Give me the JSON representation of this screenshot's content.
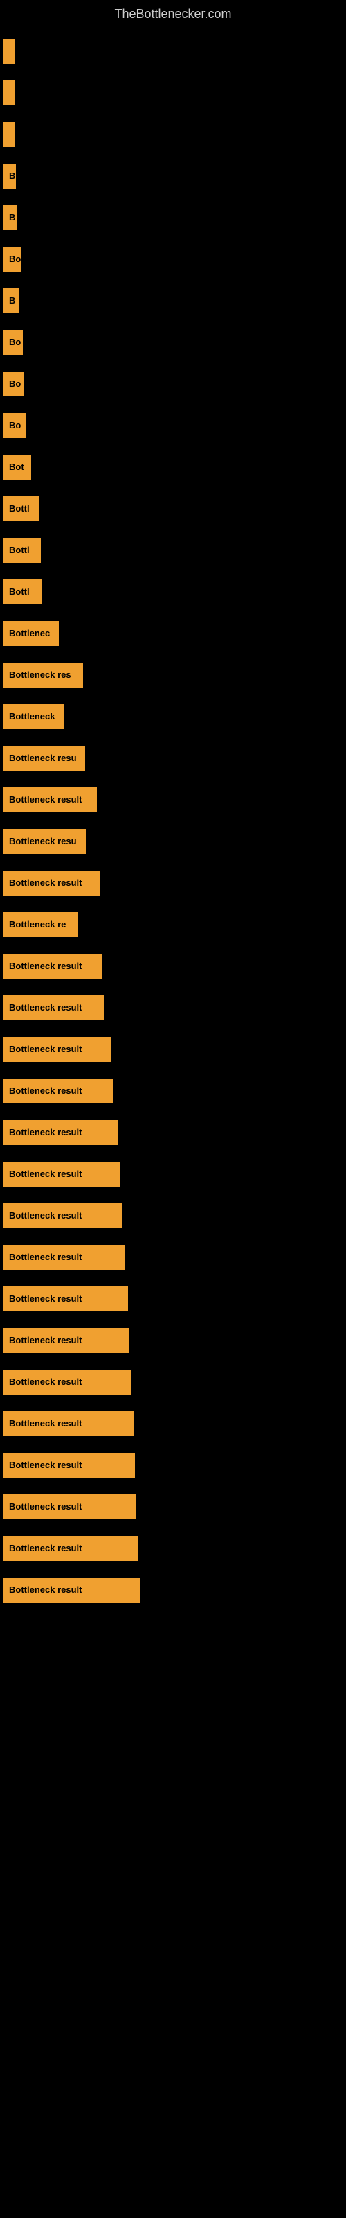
{
  "site_title": "TheBottlenecker.com",
  "bars": [
    {
      "id": 1,
      "label": "",
      "width": 8
    },
    {
      "id": 2,
      "label": "",
      "width": 10
    },
    {
      "id": 3,
      "label": "",
      "width": 12
    },
    {
      "id": 4,
      "label": "B",
      "width": 18
    },
    {
      "id": 5,
      "label": "B",
      "width": 20
    },
    {
      "id": 6,
      "label": "Bo",
      "width": 26
    },
    {
      "id": 7,
      "label": "B",
      "width": 22
    },
    {
      "id": 8,
      "label": "Bo",
      "width": 28
    },
    {
      "id": 9,
      "label": "Bo",
      "width": 30
    },
    {
      "id": 10,
      "label": "Bo",
      "width": 32
    },
    {
      "id": 11,
      "label": "Bot",
      "width": 40
    },
    {
      "id": 12,
      "label": "Bottl",
      "width": 52
    },
    {
      "id": 13,
      "label": "Bottl",
      "width": 54
    },
    {
      "id": 14,
      "label": "Bottl",
      "width": 56
    },
    {
      "id": 15,
      "label": "Bottlenec",
      "width": 80
    },
    {
      "id": 16,
      "label": "Bottleneck res",
      "width": 115
    },
    {
      "id": 17,
      "label": "Bottleneck",
      "width": 88
    },
    {
      "id": 18,
      "label": "Bottleneck resu",
      "width": 118
    },
    {
      "id": 19,
      "label": "Bottleneck result",
      "width": 135
    },
    {
      "id": 20,
      "label": "Bottleneck resu",
      "width": 120
    },
    {
      "id": 21,
      "label": "Bottleneck result",
      "width": 140
    },
    {
      "id": 22,
      "label": "Bottleneck re",
      "width": 108
    },
    {
      "id": 23,
      "label": "Bottleneck result",
      "width": 142
    },
    {
      "id": 24,
      "label": "Bottleneck result",
      "width": 145
    },
    {
      "id": 25,
      "label": "Bottleneck result",
      "width": 155
    },
    {
      "id": 26,
      "label": "Bottleneck result",
      "width": 158
    },
    {
      "id": 27,
      "label": "Bottleneck result",
      "width": 165
    },
    {
      "id": 28,
      "label": "Bottleneck result",
      "width": 168
    },
    {
      "id": 29,
      "label": "Bottleneck result",
      "width": 172
    },
    {
      "id": 30,
      "label": "Bottleneck result",
      "width": 175
    },
    {
      "id": 31,
      "label": "Bottleneck result",
      "width": 180
    },
    {
      "id": 32,
      "label": "Bottleneck result",
      "width": 182
    },
    {
      "id": 33,
      "label": "Bottleneck result",
      "width": 185
    },
    {
      "id": 34,
      "label": "Bottleneck result",
      "width": 188
    },
    {
      "id": 35,
      "label": "Bottleneck result",
      "width": 190
    },
    {
      "id": 36,
      "label": "Bottleneck result",
      "width": 192
    },
    {
      "id": 37,
      "label": "Bottleneck result",
      "width": 195
    },
    {
      "id": 38,
      "label": "Bottleneck result",
      "width": 198
    }
  ]
}
